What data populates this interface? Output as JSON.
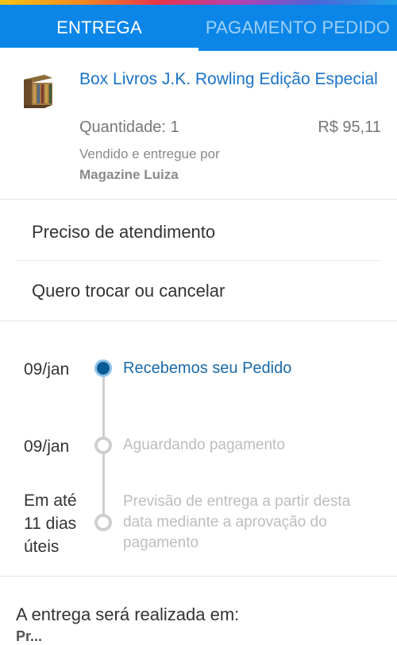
{
  "tabs": [
    {
      "label": "ENTREGA",
      "active": true
    },
    {
      "label": "PAGAMENTO PEDIDO",
      "active": false
    }
  ],
  "product": {
    "title": "Box Livros J.K. Rowling Edição Especial",
    "quantity": "Quantidade: 1",
    "price": "R$ 95,11",
    "seller_label": "Vendido e entregue por",
    "seller_name": "Magazine Luiza"
  },
  "options": [
    "Preciso de atendimento",
    "Quero trocar ou cancelar"
  ],
  "timeline": [
    {
      "date_line1": "09/jan",
      "label": "Recebemos seu Pedido",
      "status": "done"
    },
    {
      "date_line1": "09/jan",
      "label": "Aguardando pagamento",
      "status": "pending"
    },
    {
      "date_line1": "Em até",
      "date_line2": "11 dias",
      "date_line3": "úteis",
      "label": "Previsão de entrega a partir desta data mediante a aprovação do pagamento",
      "status": "pending"
    }
  ],
  "delivery": {
    "heading": "A entrega será realizada em:",
    "address_partial": "Pr..."
  },
  "colors": {
    "accent": "#0b86e8",
    "link": "#1a73c8",
    "active_step": "#0a5a94"
  }
}
